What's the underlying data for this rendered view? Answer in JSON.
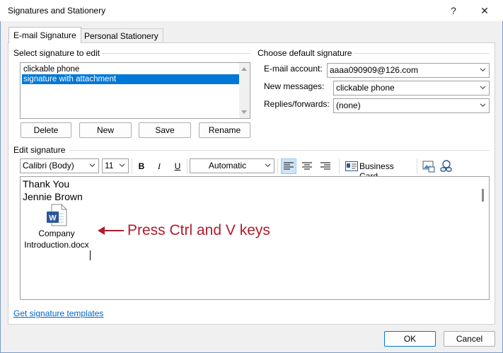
{
  "window": {
    "title": "Signatures and Stationery",
    "help_glyph": "?",
    "close_glyph": "✕"
  },
  "tabs": [
    {
      "label": "E-mail Signature",
      "active": true
    },
    {
      "label": "Personal Stationery",
      "active": false
    }
  ],
  "select_section": {
    "heading": "Select signature to edit",
    "items": [
      {
        "label": "clickable phone",
        "selected": false
      },
      {
        "label": "signature with attachment",
        "selected": true
      }
    ],
    "buttons": {
      "delete": "Delete",
      "new": "New",
      "save": "Save",
      "rename": "Rename"
    }
  },
  "default_section": {
    "heading": "Choose default signature",
    "email_account_label": "E-mail account:",
    "email_account_value": "aaaa090909@126.com",
    "new_messages_label": "New messages:",
    "new_messages_value": "clickable phone",
    "replies_label": "Replies/forwards:",
    "replies_value": "(none)"
  },
  "edit_section": {
    "heading": "Edit signature",
    "toolbar": {
      "font": "Calibri (Body)",
      "size": "11",
      "bold": "B",
      "italic": "I",
      "underline": "U",
      "color": "Automatic",
      "business_card": "Business Card"
    },
    "body_lines": [
      "Thank You",
      "Jennie Brown"
    ],
    "attachment": {
      "icon": "word-document-icon",
      "name_line1": "Company",
      "name_line2": "Introduction.docx"
    },
    "annotation": {
      "text": "Press Ctrl and V keys",
      "color": "#b01c2e"
    }
  },
  "footer": {
    "templates_link": "Get signature templates",
    "ok": "OK",
    "cancel": "Cancel"
  },
  "colors": {
    "selection": "#0078d7",
    "link": "#0066cc",
    "word_blue": "#2b579a"
  }
}
